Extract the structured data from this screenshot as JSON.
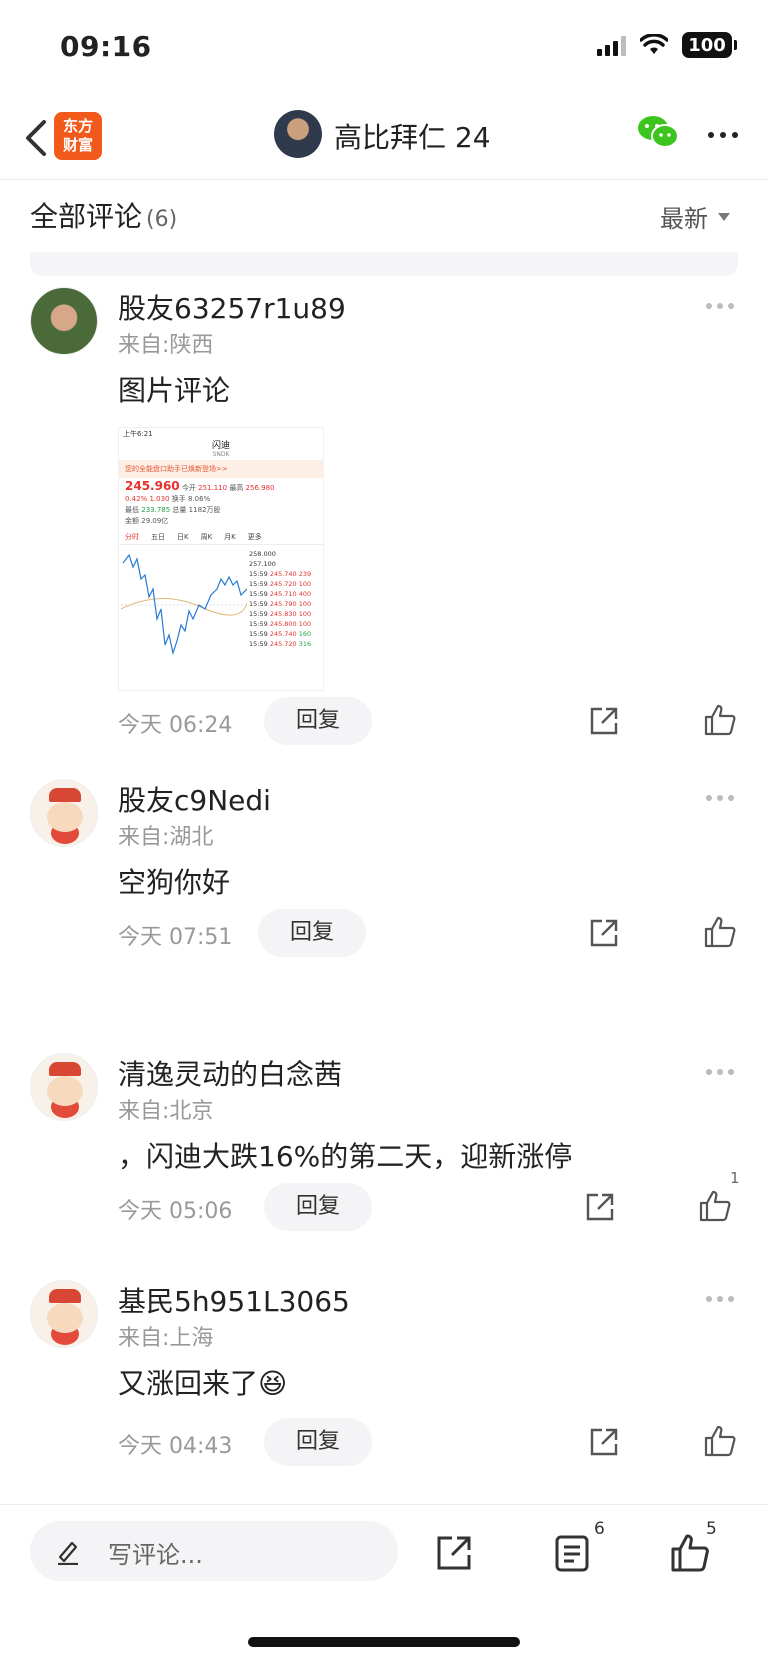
{
  "status_bar": {
    "time": "09:16",
    "battery": "100"
  },
  "nav": {
    "logo_text": "东方财富",
    "title": "高比拜仁 24"
  },
  "section": {
    "title": "全部评论",
    "count": "(6)",
    "sort_label": "最新"
  },
  "comments": [
    {
      "name": "股友63257r1u89",
      "location": "来自:陕西",
      "text": "图片评论",
      "time": "今天 06:24",
      "reply_label": "回复",
      "like_count": ""
    },
    {
      "name": "股友c9Nedi",
      "location": "来自:湖北",
      "text": "空狗你好",
      "time": "今天 07:51",
      "reply_label": "回复",
      "like_count": ""
    },
    {
      "name": "清逸灵动的白念茜",
      "location": "来自:北京",
      "text": "，闪迪大跌16%的第二天，迎新涨停",
      "time": "今天 05:06",
      "reply_label": "回复",
      "like_count": "1"
    },
    {
      "name": "基民5h951L3065",
      "location": "来自:上海",
      "text": "又涨回来了😆",
      "time": "今天 04:43",
      "reply_label": "回复",
      "like_count": ""
    }
  ],
  "chart_thumb": {
    "status": "上午6:21",
    "stock_name": "闪迪",
    "stock_code": "SNDK",
    "banner": "您的全能盘口助手已焕新登场>>",
    "price": "245.960",
    "change": "0.42%  1.030",
    "open_label": "今开",
    "open": "251.110",
    "high_label": "最高",
    "high": "256.980",
    "low_label": "最低",
    "low": "233.785",
    "turnover_label": "换手",
    "turnover": "8.06%",
    "volume_label": "总量",
    "volume": "1182万股",
    "amount_label": "金额",
    "amount": "29.09亿",
    "tabs": [
      "分时",
      "五日",
      "日K",
      "周K",
      "月K",
      "更多"
    ],
    "ask": "258.000",
    "bid": "257.100",
    "trade_times": [
      "15:59",
      "15:59",
      "15:59",
      "15:59",
      "15:59",
      "15:59",
      "15:59",
      "15:59"
    ],
    "trade_prices": [
      "245.740",
      "245.720",
      "245.710",
      "245.790",
      "245.830",
      "245.800",
      "245.740",
      "245.720"
    ],
    "trade_vols": [
      "239",
      "100",
      "400",
      "100",
      "100",
      "100",
      "160",
      "316"
    ]
  },
  "bottom_bar": {
    "placeholder": "写评论...",
    "comment_count": "6",
    "like_count": "5"
  },
  "colors": {
    "brand_orange": "#f25a1c",
    "wechat_green": "#3cc51f",
    "price_red": "#e6312d"
  }
}
